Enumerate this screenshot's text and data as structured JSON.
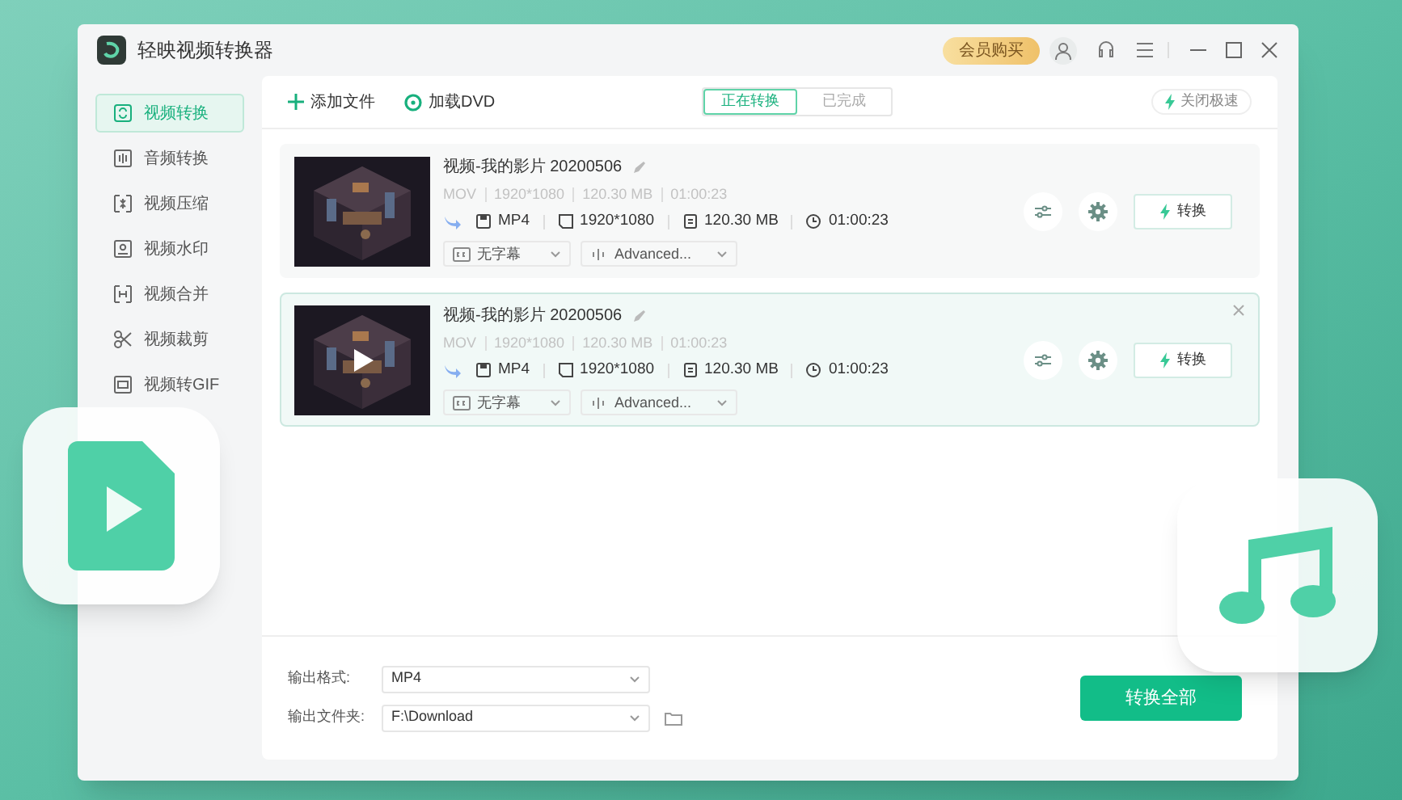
{
  "app": {
    "title": "轻映视频转换器",
    "vip_button": "会员购买"
  },
  "sidebar": {
    "items": [
      {
        "label": "视频转换",
        "selected": true
      },
      {
        "label": "音频转换",
        "selected": false
      },
      {
        "label": "视频压缩",
        "selected": false
      },
      {
        "label": "视频水印",
        "selected": false
      },
      {
        "label": "视频合并",
        "selected": false
      },
      {
        "label": "视频裁剪",
        "selected": false
      },
      {
        "label": "视频转GIF",
        "selected": false
      }
    ]
  },
  "toolbar": {
    "add_file": "添加文件",
    "load_dvd": "加载DVD",
    "tabs": [
      {
        "label": "正在转换",
        "selected": true
      },
      {
        "label": "已完成",
        "selected": false
      }
    ],
    "speed_toggle": "关闭极速"
  },
  "files": [
    {
      "name": "视频-我的影片 20200506",
      "source": [
        "MOV",
        "1920*1080",
        "120.30 MB",
        "01:00:23"
      ],
      "target": {
        "format": "MP4",
        "resolution": "1920*1080",
        "size": "120.30 MB",
        "duration": "01:00:23"
      },
      "subtitle": "无字幕",
      "audio": "Advanced...",
      "convert": "转换",
      "selected": false
    },
    {
      "name": "视频-我的影片 20200506",
      "source": [
        "MOV",
        "1920*1080",
        "120.30 MB",
        "01:00:23"
      ],
      "target": {
        "format": "MP4",
        "resolution": "1920*1080",
        "size": "120.30 MB",
        "duration": "01:00:23"
      },
      "subtitle": "无字幕",
      "audio": "Advanced...",
      "convert": "转换",
      "selected": true
    }
  ],
  "bottom": {
    "format_label": "输出格式:",
    "format": "MP4",
    "folder_label": "输出文件夹:",
    "folder": "F:\\Download",
    "convert_all": "转换全部"
  }
}
